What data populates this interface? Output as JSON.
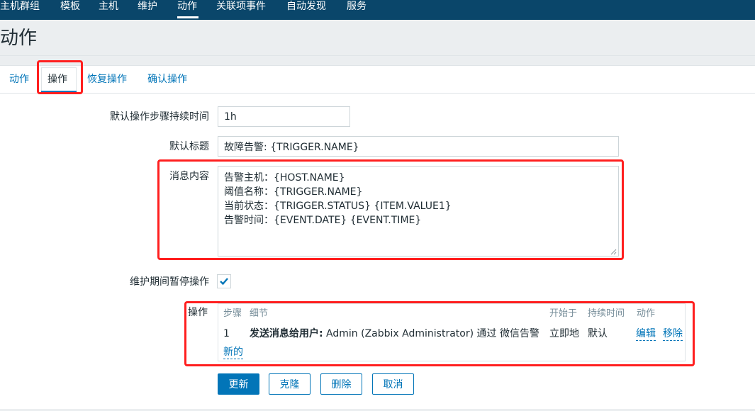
{
  "top_nav": {
    "items": [
      "主机群组",
      "模板",
      "主机",
      "维护",
      "动作",
      "关联项事件",
      "自动发现",
      "服务"
    ],
    "active": "动作"
  },
  "page_title": "动作",
  "tabs": [
    {
      "label": "动作",
      "active": false
    },
    {
      "label": "操作",
      "active": true
    },
    {
      "label": "恢复操作",
      "active": false
    },
    {
      "label": "确认操作",
      "active": false
    }
  ],
  "form": {
    "default_step_duration_label": "默认操作步骤持续时间",
    "default_step_duration_value": "1h",
    "default_subject_label": "默认标题",
    "default_subject_value": "故障告警: {TRIGGER.NAME}",
    "message_label": "消息内容",
    "message_value": "告警主机：{HOST.NAME}\n阈值名称：{TRIGGER.NAME}\n当前状态：{TRIGGER.STATUS} {ITEM.VALUE1}\n告警时间：{EVENT.DATE} {EVENT.TIME}",
    "pause_label": "维护期间暂停操作",
    "pause_checked": true,
    "operations_label": "操作"
  },
  "operations_table": {
    "headers": {
      "steps": "步骤",
      "details": "细节",
      "start_in": "开始于",
      "duration": "持续时间",
      "action": "动作"
    },
    "rows": [
      {
        "step": "1",
        "detail_bold": "发送消息给用户:",
        "detail_rest": " Admin (Zabbix Administrator) 通过 微信告警",
        "start_in": "立即地",
        "duration": "默认",
        "edit": "编辑",
        "remove": "移除"
      }
    ],
    "new_link": "新的"
  },
  "buttons": {
    "update": "更新",
    "clone": "克隆",
    "delete": "删除",
    "cancel": "取消"
  },
  "colors": {
    "nav_bg": "#0a466a",
    "accent": "#0275b8",
    "highlight": "#ff1f1f"
  }
}
